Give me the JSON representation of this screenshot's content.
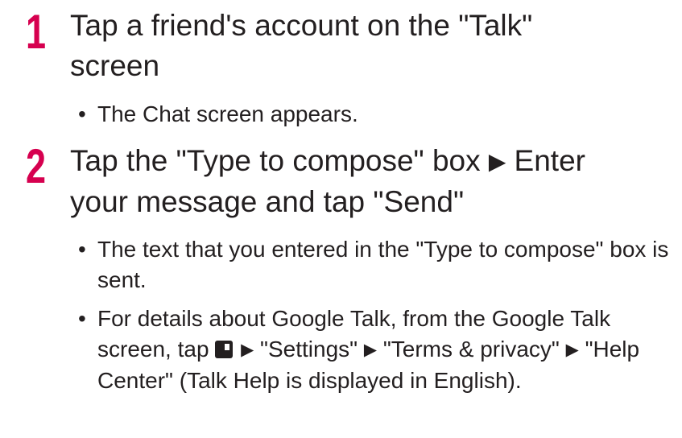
{
  "colors": {
    "step_number": "#d6004f",
    "text": "#231f20"
  },
  "steps": [
    {
      "number": "1",
      "title_line1": "Tap a friend's account on the \"Talk\"",
      "title_line2": "screen",
      "bullets": [
        "The Chat screen appears."
      ]
    },
    {
      "number": "2",
      "title_part1": "Tap the \"Type to compose\" box",
      "title_part2": "Enter",
      "title_line2": "your message and tap \"Send\"",
      "bullets": [
        "The text that you entered in the \"Type to compose\" box is sent."
      ],
      "details": {
        "part1": "For details about Google Talk, from the Google Talk screen, tap",
        "icon": "menu-key-icon",
        "part2": "\"Settings\"",
        "part3": "\"Terms & privacy\"",
        "part4": "\"Help Center\" (Talk Help is displayed in English)."
      }
    }
  ],
  "arrow_glyph": "▶"
}
